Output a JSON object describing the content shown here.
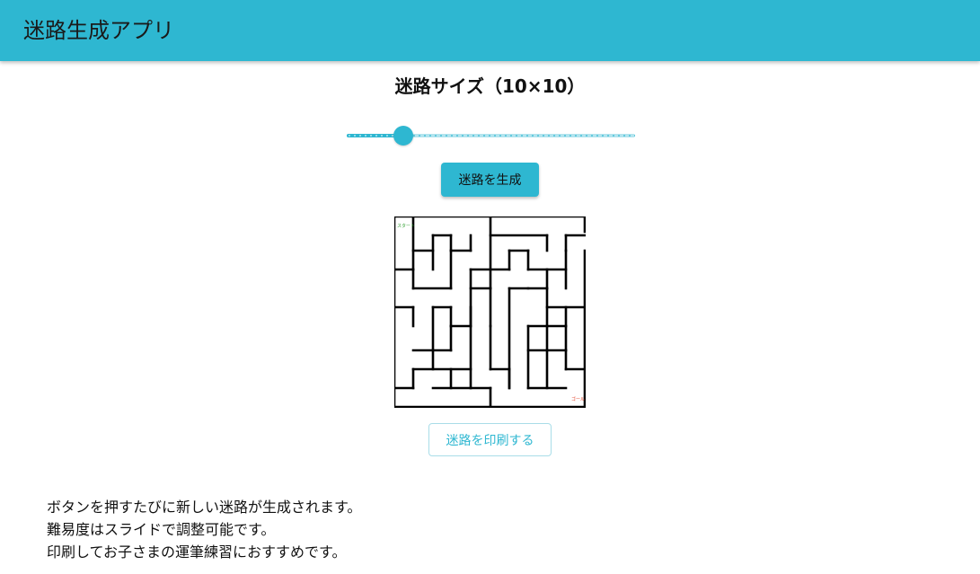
{
  "app": {
    "title": "迷路生成アプリ"
  },
  "size_control": {
    "title": "迷路サイズ（10×10）",
    "value": 10,
    "min": 5,
    "max": 50
  },
  "buttons": {
    "generate_label": "迷路を生成",
    "print_label": "迷路を印刷する"
  },
  "maze": {
    "start_label": "スタート",
    "goal_label": "ゴール"
  },
  "description": {
    "lines": [
      "ボタンを押すたびに新しい迷路が生成されます。",
      "難易度はスライドで調整可能です。",
      "印刷してお子さまの運筆練習におすすめです。"
    ]
  },
  "colors": {
    "accent": "#2eb7d1",
    "start": "#2e9e2e",
    "goal": "#e0351b"
  }
}
